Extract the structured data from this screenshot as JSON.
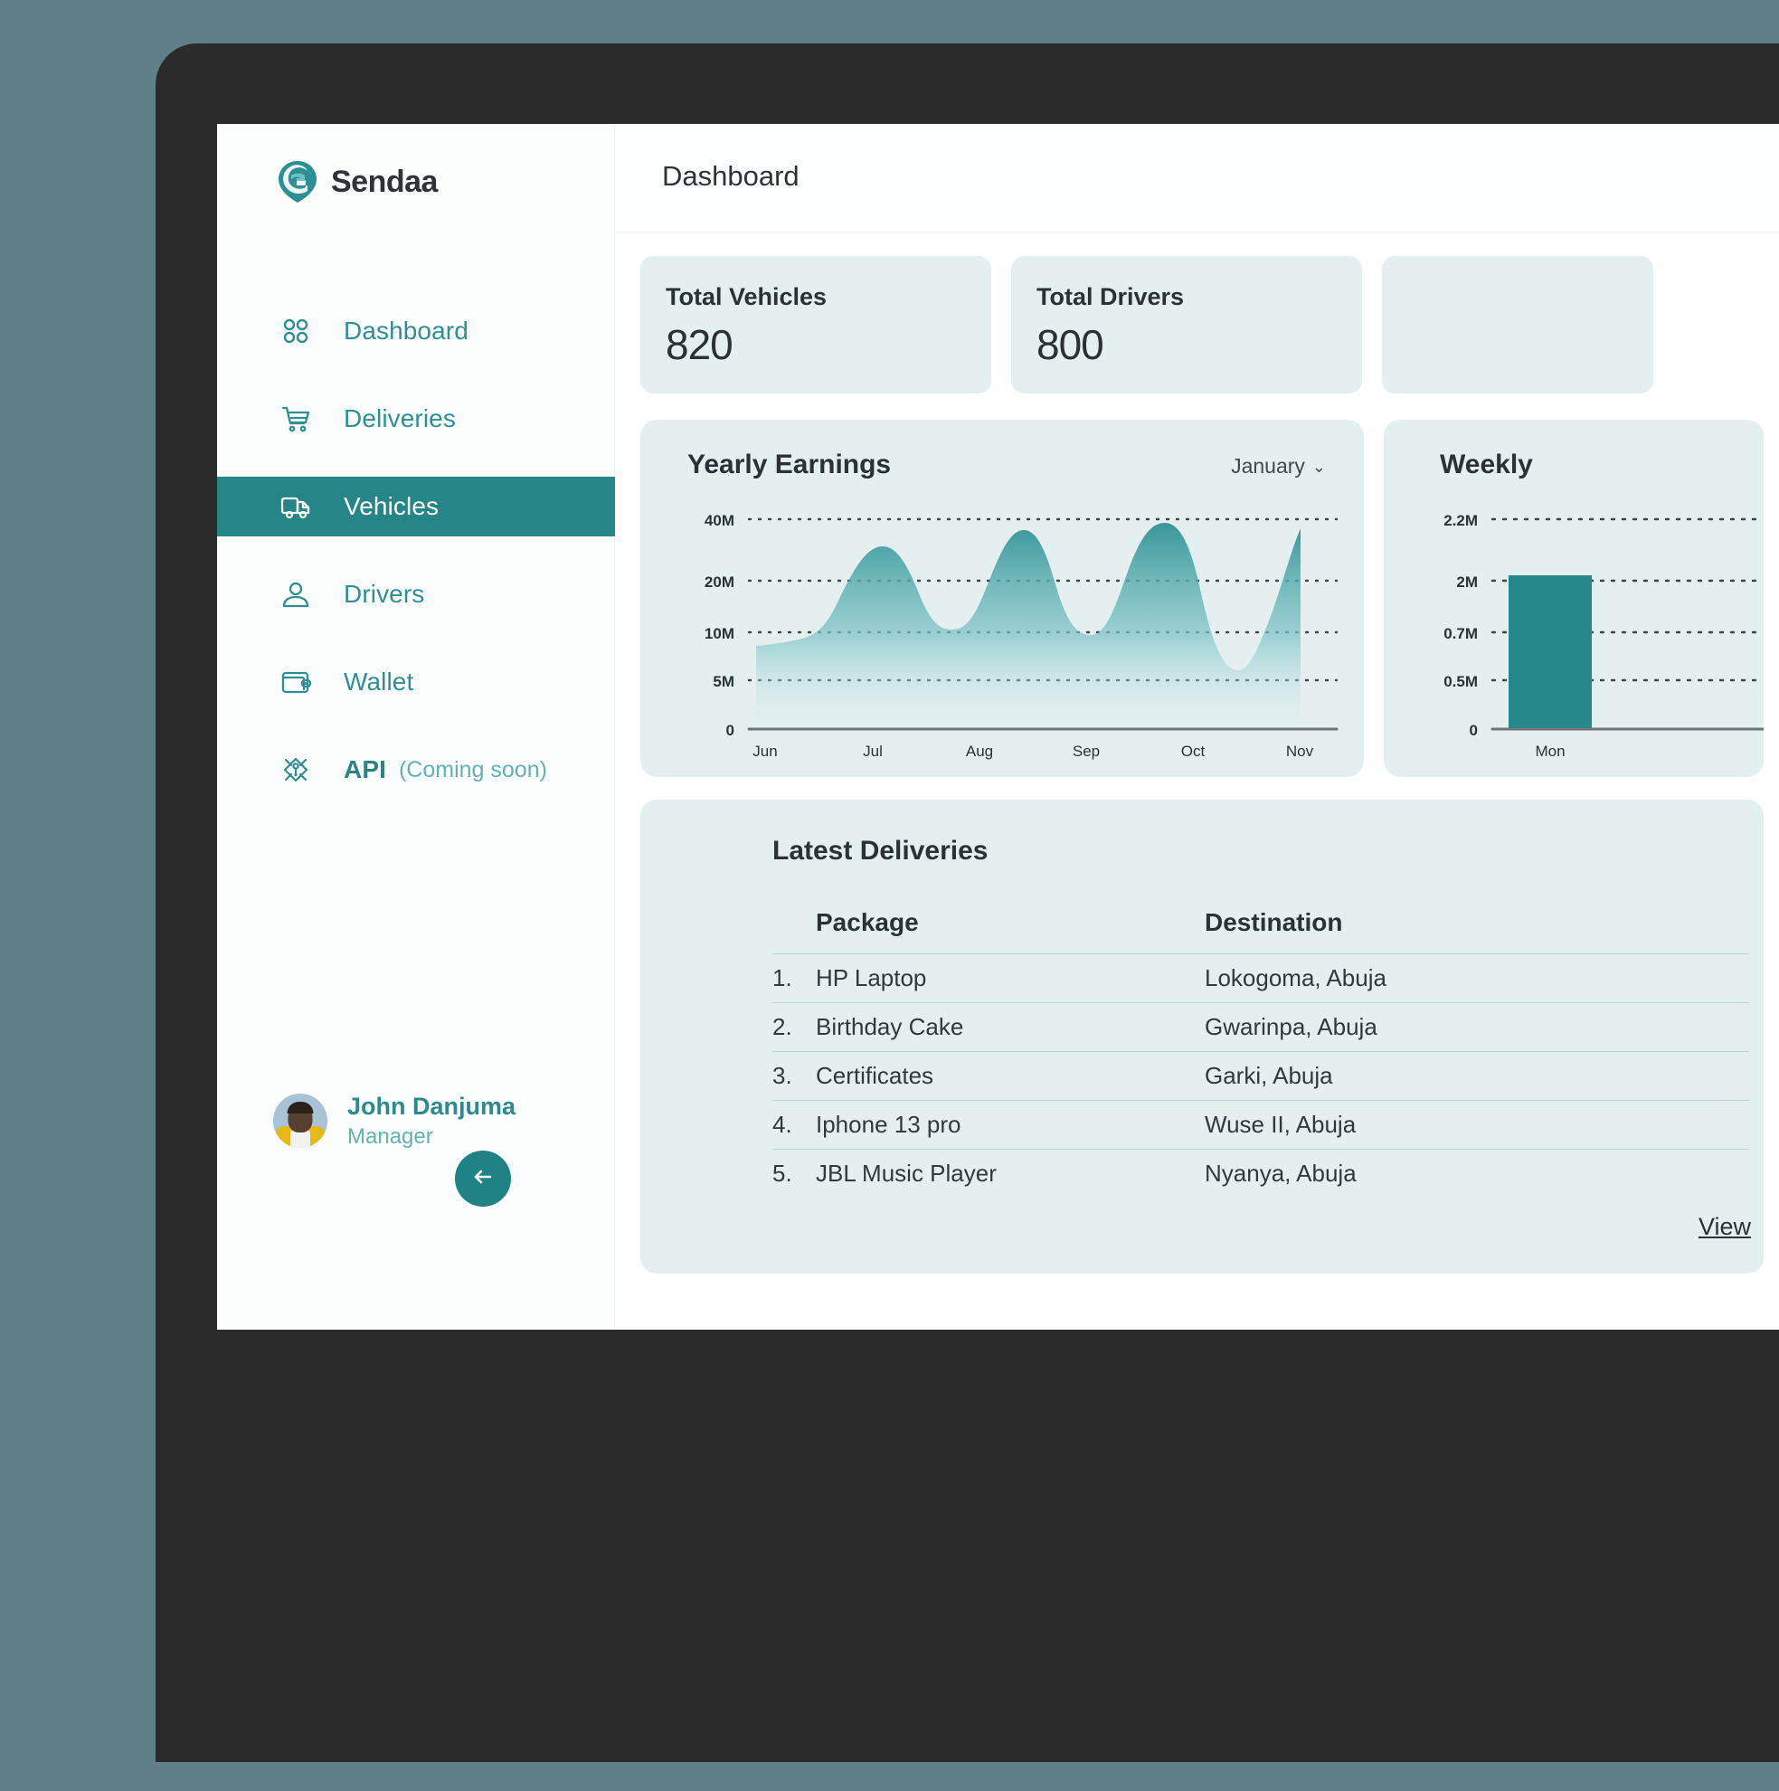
{
  "brand": {
    "name": "Sendaa"
  },
  "sidebar": {
    "items": [
      {
        "label": "Dashboard",
        "icon": "grid-icon",
        "active": false
      },
      {
        "label": "Deliveries",
        "icon": "cart-icon",
        "active": false
      },
      {
        "label": "Vehicles",
        "icon": "truck-icon",
        "active": true
      },
      {
        "label": "Drivers",
        "icon": "user-icon",
        "active": false
      },
      {
        "label": "Wallet",
        "icon": "wallet-icon",
        "active": false
      },
      {
        "label": "API",
        "sublabel": "(Coming soon)",
        "icon": "api-node-icon",
        "active": false
      }
    ],
    "profile": {
      "name": "John Danjuma",
      "role": "Manager"
    },
    "back_button": "back-arrow-icon"
  },
  "header": {
    "title": "Dashboard"
  },
  "stats": [
    {
      "title": "Total Vehicles",
      "value": "820"
    },
    {
      "title": "Total Drivers",
      "value": "800"
    },
    {
      "title": "",
      "value": ""
    }
  ],
  "deliveries": {
    "title": "Latest Deliveries",
    "columns": [
      "Package",
      "Destination"
    ],
    "rows": [
      {
        "index": "1.",
        "package": "HP Laptop",
        "destination": "Lokogoma, Abuja"
      },
      {
        "index": "2.",
        "package": "Birthday Cake",
        "destination": "Gwarinpa, Abuja"
      },
      {
        "index": "3.",
        "package": "Certificates",
        "destination": "Garki, Abuja"
      },
      {
        "index": "4.",
        "package": "Iphone 13 pro",
        "destination": "Wuse II, Abuja"
      },
      {
        "index": "5.",
        "package": "JBL Music Player",
        "destination": "Nyanya, Abuja"
      }
    ],
    "view_link": "View"
  },
  "colors": {
    "accent": "#258587",
    "accent_light": "#62b2b4",
    "card_bg": "#e4f0f0",
    "text_dark": "#2b3136",
    "bezel": "#2b2b2b"
  },
  "chart_data": [
    {
      "type": "area",
      "title": "Yearly Earnings",
      "dropdown_value": "January",
      "xlabel": "",
      "ylabel": "",
      "categories": [
        "Jun",
        "Jul",
        "Aug",
        "Sep",
        "Oct",
        "Nov"
      ],
      "ytick_labels": [
        "40M",
        "20M",
        "10M",
        "5M",
        "0"
      ],
      "ytick_values": [
        40,
        20,
        10,
        5,
        0
      ],
      "ylim": [
        0,
        45
      ],
      "grid": true,
      "x": [
        0,
        0.25,
        0.5,
        0.75,
        1.0,
        1.3,
        1.6,
        2.0,
        2.35,
        2.7,
        3.0,
        3.4,
        3.75,
        4.1,
        4.4,
        4.75,
        5.0
      ],
      "values": [
        10,
        11,
        11.5,
        12,
        16,
        28,
        18,
        17,
        36,
        17,
        16,
        40,
        19,
        9,
        8,
        16,
        41
      ],
      "legend": []
    },
    {
      "type": "bar",
      "title": "Weekly",
      "categories": [
        "Mon"
      ],
      "values": [
        2.0
      ],
      "ytick_labels": [
        "2.2M",
        "2M",
        "0.7M",
        "0.5M",
        "0"
      ],
      "ytick_values": [
        2.2,
        2.0,
        0.7,
        0.5,
        0
      ],
      "ylim": [
        0,
        2.4
      ],
      "grid": true
    }
  ]
}
